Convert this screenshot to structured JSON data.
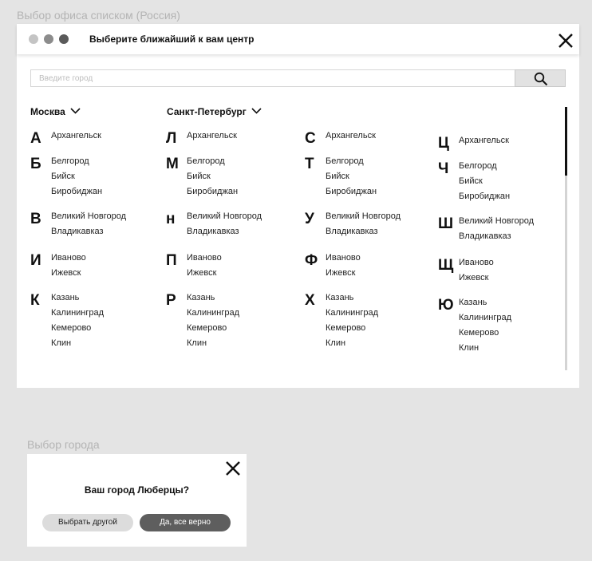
{
  "labels": {
    "list_frame": "Выбор офиса списком (Россия)",
    "city_frame": "Выбор города"
  },
  "header": {
    "title": "Выберите ближайший к вам центр",
    "dot_colors": [
      "#c4c4c4",
      "#8c8c8c",
      "#5a5a5a"
    ]
  },
  "search": {
    "placeholder": "Введите город",
    "icon": "search-icon"
  },
  "regions": {
    "moscow": "Москва",
    "spb": "Санкт-Петербург"
  },
  "columns": [
    [
      {
        "letter": "А",
        "cities": [
          "Архангельск"
        ]
      },
      {
        "letter": "Б",
        "cities": [
          "Белгород",
          "Бийск",
          "Биробиджан"
        ]
      },
      {
        "letter": "В",
        "cities": [
          "Великий Новгород",
          "Владикавказ"
        ]
      },
      {
        "letter": "И",
        "cities": [
          "Иваново",
          "Ижевск"
        ]
      },
      {
        "letter": "К",
        "cities": [
          "Казань",
          "Калининград",
          "Кемерово",
          "Клин"
        ]
      }
    ],
    [
      {
        "letter": "Л",
        "cities": [
          "Архангельск"
        ]
      },
      {
        "letter": "М",
        "cities": [
          "Белгород",
          "Бийск",
          "Биробиджан"
        ]
      },
      {
        "letter": "н",
        "cities": [
          "Великий Новгород",
          "Владикавказ"
        ]
      },
      {
        "letter": "П",
        "cities": [
          "Иваново",
          "Ижевск"
        ]
      },
      {
        "letter": "Р",
        "cities": [
          "Казань",
          "Калининград",
          "Кемерово",
          "Клин"
        ]
      }
    ],
    [
      {
        "letter": "С",
        "cities": [
          "Архангельск"
        ]
      },
      {
        "letter": "Т",
        "cities": [
          "Белгород",
          "Бийск",
          "Биробиджан"
        ]
      },
      {
        "letter": "У",
        "cities": [
          "Великий Новгород",
          "Владикавказ"
        ]
      },
      {
        "letter": "Ф",
        "cities": [
          "Иваново",
          "Ижевск"
        ]
      },
      {
        "letter": "Х",
        "cities": [
          "Казань",
          "Калининград",
          "Кемерово",
          "Клин"
        ]
      }
    ],
    [
      {
        "letter": "Ц",
        "cities": [
          "Архангельск"
        ]
      },
      {
        "letter": "Ч",
        "cities": [
          "Белгород",
          "Бийск",
          "Биробиджан"
        ]
      },
      {
        "letter": "Ш",
        "cities": [
          "Великий Новгород",
          "Владикавказ"
        ]
      },
      {
        "letter": "Щ",
        "cities": [
          "Иваново",
          "Ижевск"
        ]
      },
      {
        "letter": "Ю",
        "cities": [
          "Казань",
          "Калининград",
          "Кемерово",
          "Клин"
        ]
      }
    ]
  ],
  "city_dialog": {
    "question": "Ваш город Люберцы?",
    "other_button": "Выбрать другой",
    "confirm_button": "Да, все верно"
  }
}
